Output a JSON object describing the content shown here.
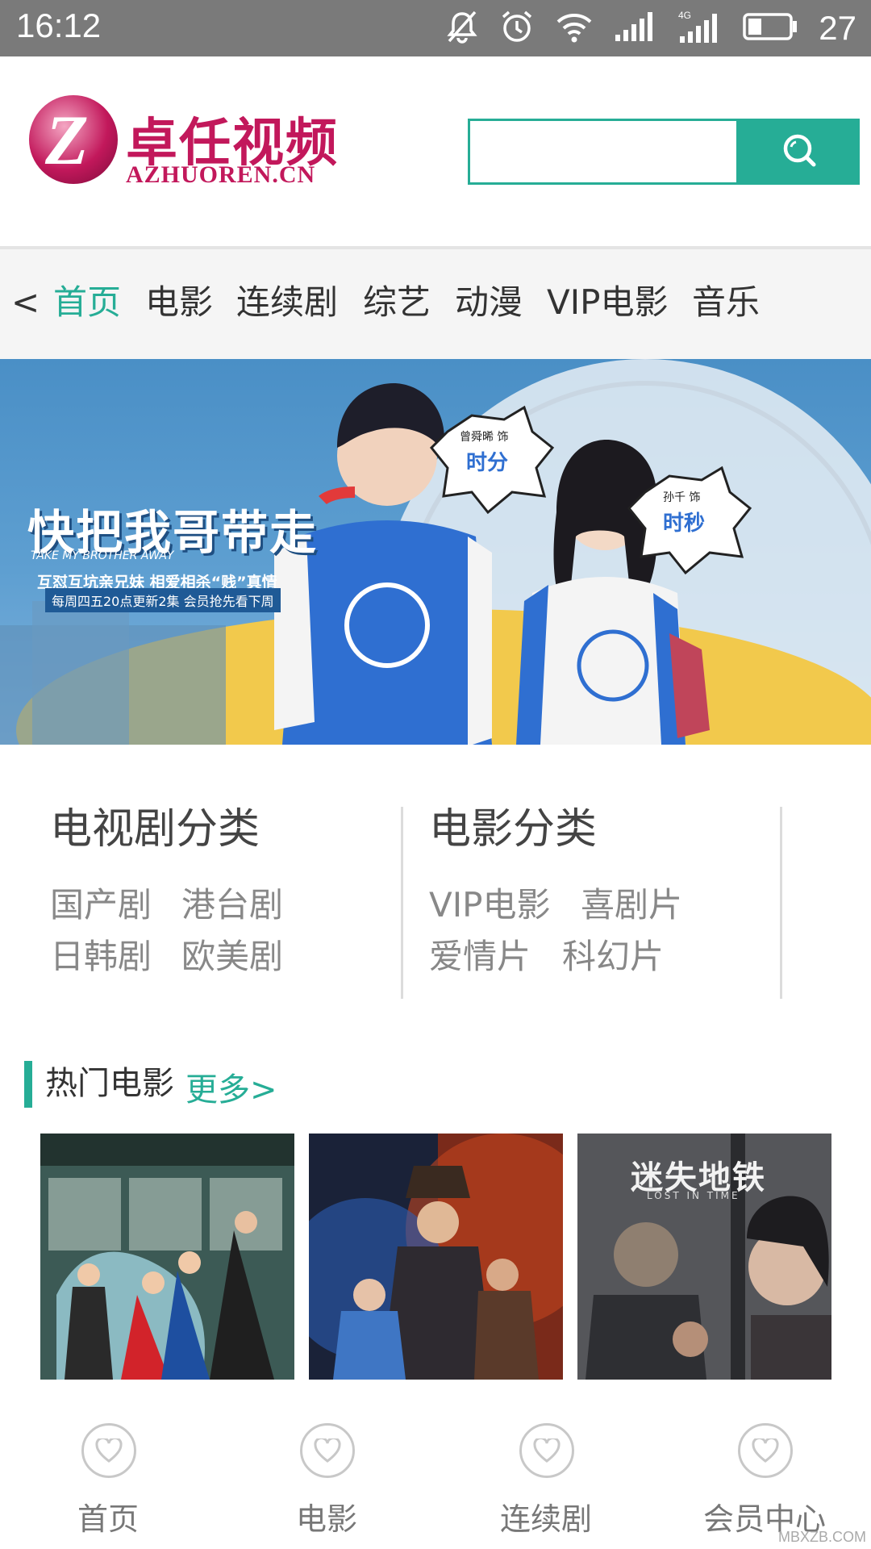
{
  "status_bar": {
    "time": "16:12",
    "battery": "27"
  },
  "header": {
    "logo_name": "卓任视频",
    "logo_domain": "AZHUOREN.CN",
    "search_placeholder": ""
  },
  "nav": {
    "back": "<",
    "items": [
      "首页",
      "电影",
      "连续剧",
      "综艺",
      "动漫",
      "VIP电影",
      "音乐"
    ]
  },
  "banner": {
    "title": "快把我哥带走",
    "subtitle_en": "TAKE MY BROTHER AWAY",
    "tagline": "互怼互坑亲兄妹  相爱相杀“贱”真情",
    "schedule": "每周四五20点更新2集  会员抢先看下周",
    "bubble1_top": "曾舜晞 饰",
    "bubble1_name": "时分",
    "bubble2_top": "孙千 饰",
    "bubble2_name": "时秒"
  },
  "categories": {
    "tv": {
      "title": "电视剧分类",
      "links": [
        "国产剧",
        "港台剧",
        "日韩剧",
        "欧美剧"
      ]
    },
    "movie": {
      "title": "电影分类",
      "links": [
        "VIP电影",
        "喜剧片",
        "爱情片",
        "科幻片"
      ]
    }
  },
  "hot_movies": {
    "title": "热门电影",
    "more": "更多>",
    "poster3_title": "迷失地铁",
    "poster3_subtitle": "LOST IN TIME"
  },
  "tabbar": {
    "items": [
      "首页",
      "电影",
      "连续剧",
      "会员中心"
    ]
  },
  "watermark": "MBXZB.COM",
  "colors": {
    "accent": "#26ad96",
    "brand": "#c2185b",
    "status_bar": "#7a7a7a"
  }
}
